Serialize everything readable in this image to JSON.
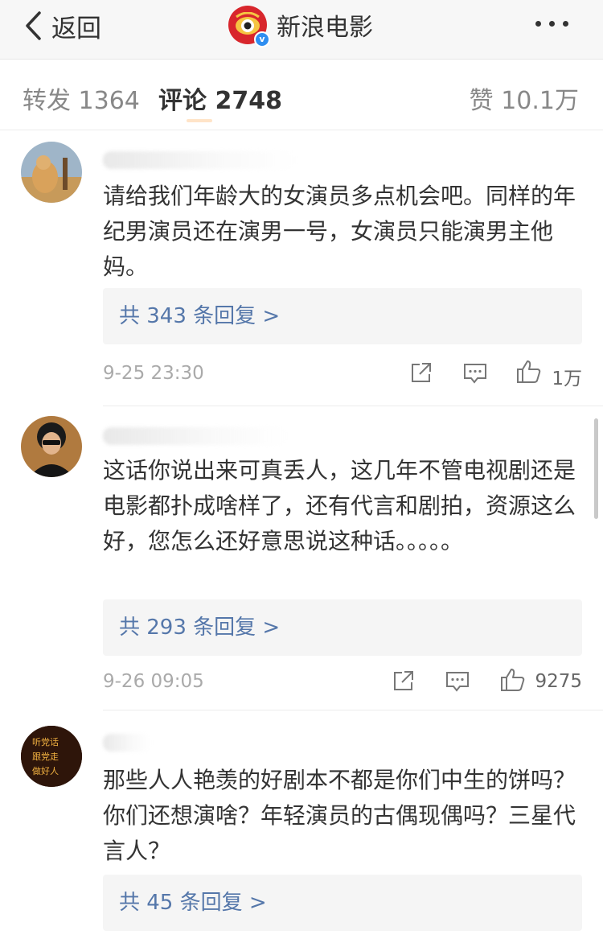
{
  "nav": {
    "back_label": "返回",
    "title": "新浪电影",
    "accent": "#d8262c"
  },
  "tabs": {
    "repost": "转发 1364",
    "comment": "评论 2748",
    "like": "赞 10.1万"
  },
  "comments": [
    {
      "text": "请给我们年龄大的女演员多点机会吧。同样的年纪男演员还在演男一号，女演员只能演男主他妈。",
      "replies": "共 343 条回复 >",
      "time": "9-25 23:30",
      "likes": "1万"
    },
    {
      "text": "这话你说出来可真丢人，这几年不管电视剧还是电影都扑成啥样了，还有代言和剧拍，资源这么好，您怎么还好意思说这种话。。。。。",
      "replies": "共 293 条回复 >",
      "time": "9-26 09:05",
      "likes": "9275"
    },
    {
      "text": "那些人人艳羡的好剧本不都是你们中生的饼吗？你们还想演啥？年轻演员的古偶现偶吗？三星代言人？",
      "replies": "共 45 条回复 >"
    }
  ],
  "avatar3_sign": [
    "听党话",
    "跟党走",
    "做好人"
  ]
}
